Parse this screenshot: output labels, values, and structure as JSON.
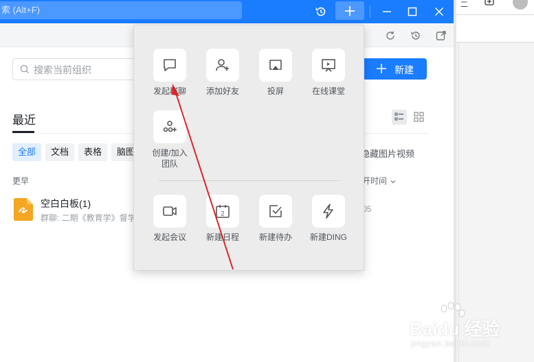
{
  "topbar": {
    "search_placeholder": "索 (Alt+F)"
  },
  "main": {
    "org_search_placeholder": "搜索当前组织",
    "new_button_label": "新建",
    "section_title": "最近",
    "filters": [
      "全部",
      "文档",
      "表格",
      "脑图"
    ],
    "hide_media_label": "隐藏图片视频",
    "group_label": "更早",
    "sort_label": "开时间",
    "file": {
      "name": "空白白板(1)",
      "subtitle": "群聊: 二期《教育学》督学",
      "date": "05"
    }
  },
  "popup": {
    "items": [
      {
        "label": "发起群聊",
        "icon": "chat-bubble-icon"
      },
      {
        "label": "添加好友",
        "icon": "add-friend-icon"
      },
      {
        "label": "投屏",
        "icon": "screen-cast-icon"
      },
      {
        "label": "在线课堂",
        "icon": "online-class-icon"
      },
      {
        "label": "创建/加入\n团队",
        "icon": "team-icon"
      },
      {
        "label": "发起会议",
        "icon": "video-meeting-icon"
      },
      {
        "label": "新建日程",
        "icon": "calendar-icon"
      },
      {
        "label": "新建待办",
        "icon": "todo-check-icon"
      },
      {
        "label": "新建DING",
        "icon": "ding-lightning-icon"
      }
    ],
    "calendar_day": "2"
  },
  "watermark": {
    "text": "Baidu 经验",
    "sub": "jingyan.baidu.com"
  },
  "colors": {
    "accent": "#1a7cff",
    "annotation_arrow": "#d9262c"
  }
}
